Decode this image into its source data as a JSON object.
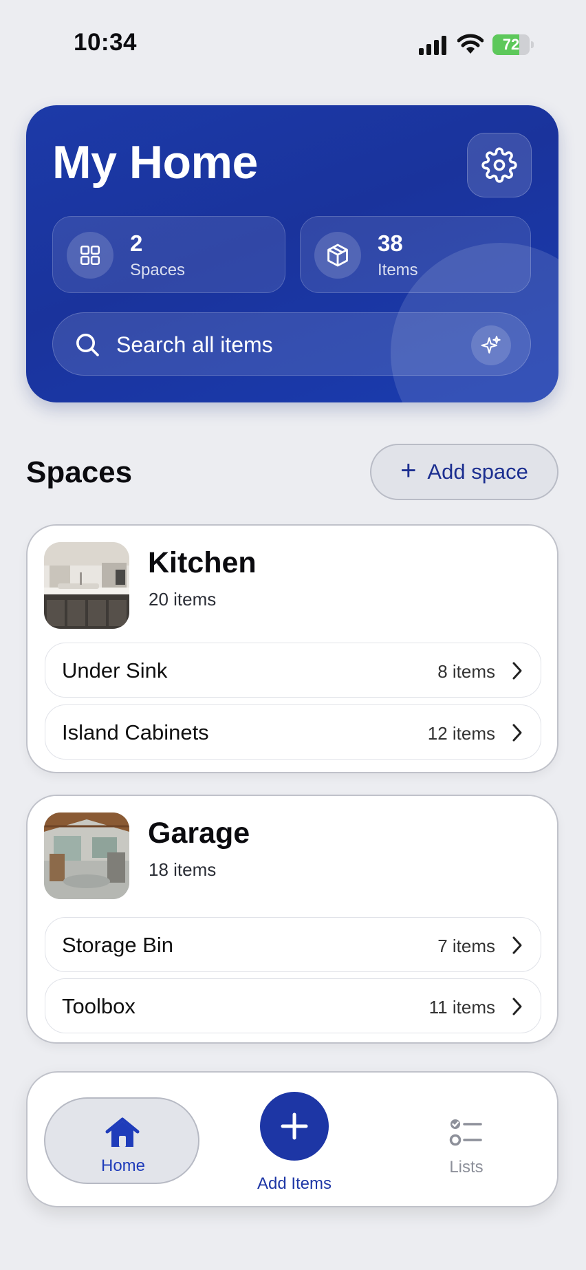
{
  "status_bar": {
    "time": "10:34",
    "battery": "72",
    "battery_level": 0.72
  },
  "header": {
    "title": "My Home",
    "stats": [
      {
        "value": "2",
        "label": "Spaces"
      },
      {
        "value": "38",
        "label": "Items"
      }
    ],
    "search_placeholder": "Search all items"
  },
  "spaces_section": {
    "title": "Spaces",
    "add_label": "Add space",
    "spaces": [
      {
        "name": "Kitchen",
        "count": "20 items",
        "areas": [
          {
            "name": "Under Sink",
            "count": "8 items"
          },
          {
            "name": "Island Cabinets",
            "count": "12 items"
          }
        ]
      },
      {
        "name": "Garage",
        "count": "18 items",
        "areas": [
          {
            "name": "Storage Bin",
            "count": "7 items"
          },
          {
            "name": "Toolbox",
            "count": "11 items"
          }
        ]
      }
    ]
  },
  "nav": {
    "home": "Home",
    "add": "Add Items",
    "lists": "Lists"
  },
  "colors": {
    "accent": "#1d36a5",
    "hero": "#1a339c",
    "battery": "#5dc85b"
  }
}
